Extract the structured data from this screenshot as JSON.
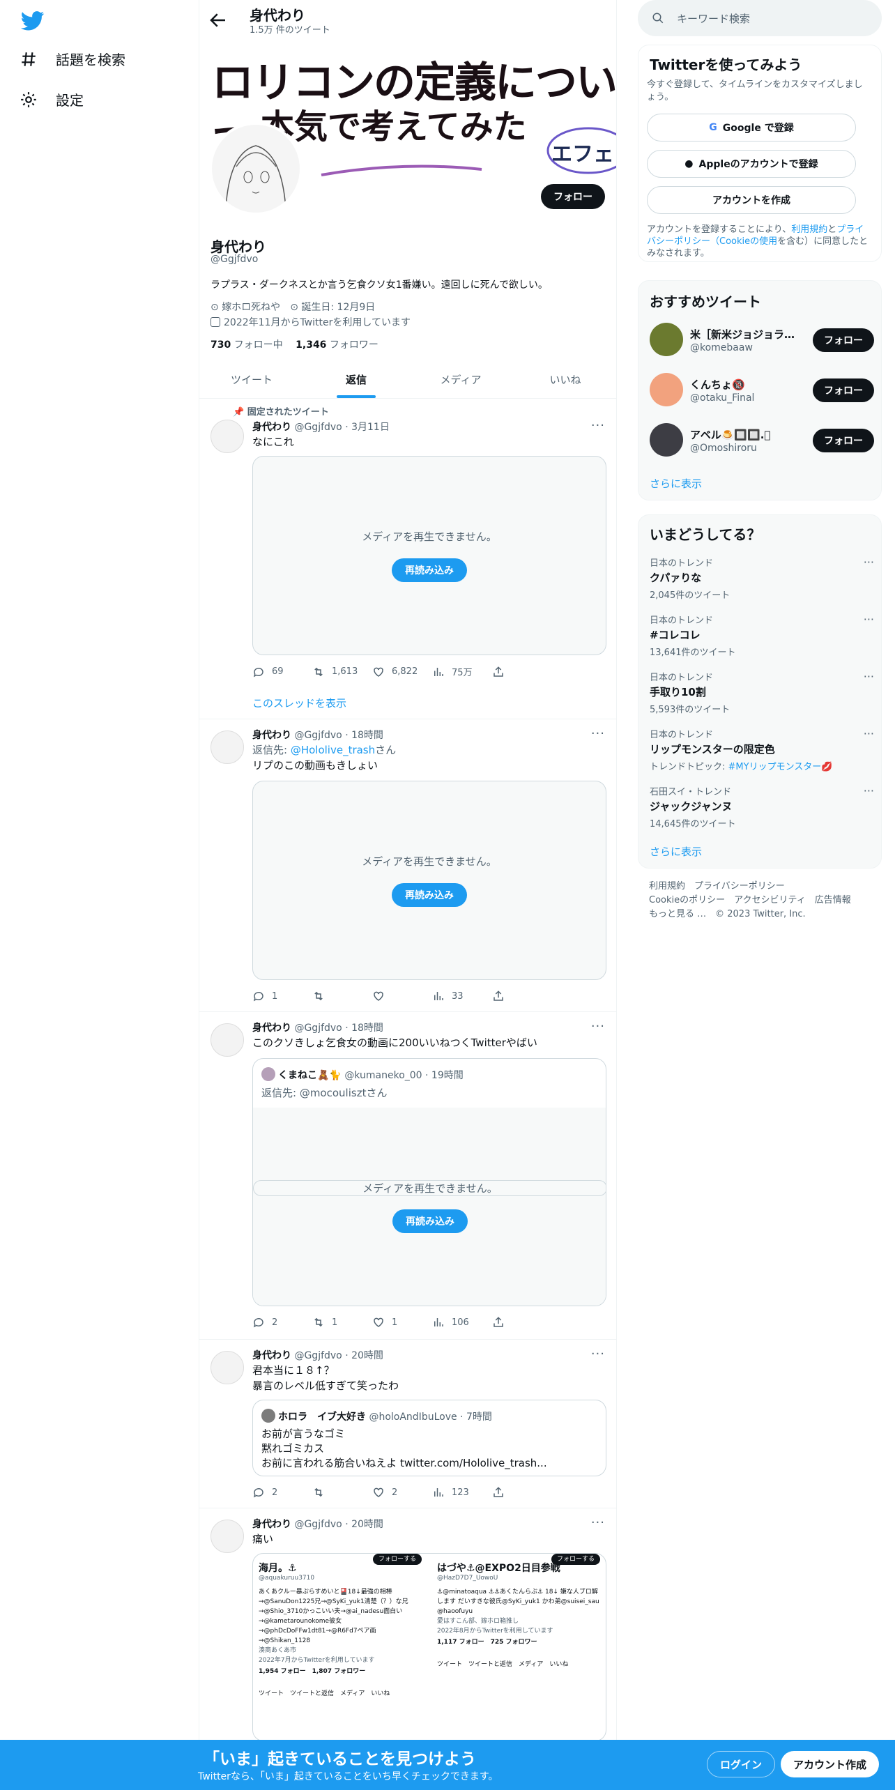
{
  "nav": {
    "explore_label": "話題を検索",
    "settings_label": "設定"
  },
  "header": {
    "title": "身代わり",
    "tweet_count": "1.5万 件のツイート"
  },
  "banner": {
    "line1": "ロリコンの定義について",
    "line2": "本気で考えてみた",
    "side_text": "エフェ"
  },
  "profile": {
    "follow_label": "フォロー",
    "name": "身代わり",
    "handle": "@Ggjfdvo",
    "bio": "ラプラス・ダークネスとか言う乞食クソ女1番嫌い。遠回しに死んで欲しい。",
    "location": "嫁ホロ死ねや",
    "birthday": "誕生日: 12月9日",
    "joined": "2022年11月からTwitterを利用しています",
    "following_count": "730",
    "following_label": "フォロー中",
    "followers_count": "1,346",
    "followers_label": "フォロワー"
  },
  "tabs": [
    {
      "label": "ツイート"
    },
    {
      "label": "返信"
    },
    {
      "label": "メディア"
    },
    {
      "label": "いいね"
    }
  ],
  "pinned_label": "固定されたツイート",
  "media_unavailable": "メディアを再生できません。",
  "reload_label": "再読み込み",
  "tweets": [
    {
      "name": "身代わり",
      "meta": "@Ggjfdvo · 3月11日",
      "text": "なにこれ",
      "reply": "69",
      "retweet": "1,613",
      "like": "6,822",
      "views": "75万",
      "thread_link": "このスレッドを表示"
    },
    {
      "name": "身代わり",
      "meta": "@Ggjfdvo · 18時間",
      "reply_to_prefix": "返信先: ",
      "reply_to_user": "@Hololive_trash",
      "reply_to_suffix": "さん",
      "text": "リプのこの動画もきしょい",
      "reply": "1",
      "retweet": "",
      "like": "",
      "views": "33"
    },
    {
      "name": "身代わり",
      "meta": "@Ggjfdvo · 18時間",
      "text": "このクソきしょ乞食女の動画に200いいねつくTwitterやばい",
      "quote_name": "くまねこ🧸🐈",
      "quote_meta": "@kumaneko_00 · 19時間",
      "quote_reply": "返信先: @mocoulisztさん",
      "reply": "2",
      "retweet": "1",
      "like": "1",
      "views": "106"
    },
    {
      "name": "身代わり",
      "meta": "@Ggjfdvo · 20時間",
      "text1": "君本当に１８↑？",
      "text2": "暴言のレベル低すぎて笑ったわ",
      "quote_name": "ホロラ　イブ大好き",
      "quote_meta": "@holoAndIbuLove · 7時間",
      "quote_l1": "お前が言うなゴミ",
      "quote_l2": "黙れゴミカス",
      "quote_l3": "お前に言われる筋合いねえよ twitter.com/Hololive_trash...",
      "reply": "2",
      "retweet": "",
      "like": "2",
      "views": "123"
    },
    {
      "name": "身代わり",
      "meta": "@Ggjfdvo · 20時間",
      "text": "痛い",
      "shot_left": {
        "follow": "フォローする",
        "name": "海月。⚓",
        "handle": "@aquakuruu3710",
        "bio": "あくあクルー暴ぷらすめいと🎴18↓最強の相棒→@SanuDon1225兄→@SyKi_yuk1清楚（？）な兄→@Shio_3710かっこいい夫→@ai_nadesu面白い→@kametarounokome彼女→@phDcDoFFw1dt81→@R6Fd7ペア画→@Shikan_1128",
        "place": "湊商あくあ市",
        "joined": "2022年7月からTwitterを利用しています",
        "stats": "1,954 フォロー　1,807 フォロワー",
        "tabs": "ツイート　ツイートと返信　メディア　いいね"
      },
      "shot_right": {
        "follow": "フォローする",
        "name": "はづや⚓@EXPO2日目参戦",
        "handle": "@HazD7D7_UowoU",
        "bio": "⚓@minatoaqua ⚓⚓あくたんらぶ⚓ 18↓ 嫌な人ブロ解します だいすきな彼氏@SyKi_yuk1 かわ弟@suisei_sau @haoofuyu",
        "place": "愛はすこん部、嫁ホロ箱推し",
        "joined": "2022年8月からTwitterを利用しています",
        "stats": "1,117 フォロー　725 フォロワー",
        "tabs": "ツイート　ツイートと返信　メディア　いいね"
      }
    }
  ],
  "right": {
    "search_placeholder": "キーワード検索",
    "signup": {
      "title": "Twitterを使ってみよう",
      "desc": "今すぐ登録して、タイムラインをカスタマイズしましょう。",
      "google": "Google で登録",
      "apple": "Appleのアカウントで登録",
      "create": "アカウントを作成",
      "legal_1": "アカウントを登録することにより、",
      "legal_terms": "利用規約",
      "legal_and": "と",
      "legal_privacy": "プライバシーポリシー（Cookieの使用",
      "legal_2": "を含む）に同意したとみなされます。"
    },
    "recommend": {
      "title": "おすすめツイート",
      "users": [
        {
          "name": "米［新米ジョジョラ…",
          "handle": "@komebaaw",
          "follow": "フォロー"
        },
        {
          "name": "くんちょ🔞",
          "handle": "@otaku_Final",
          "follow": "フォロー"
        },
        {
          "name": "アベル🍮🔲🔲.ﾟ",
          "handle": "@Omoshiroru",
          "follow": "フォロー"
        }
      ],
      "more": "さらに表示"
    },
    "trends": {
      "title": "いまどうしてる？",
      "items": [
        {
          "context": "日本のトレンド",
          "name": "クパァりな",
          "count": "2,045件のツイート"
        },
        {
          "context": "日本のトレンド",
          "name": "#コレコレ",
          "count": "13,641件のツイート"
        },
        {
          "context": "日本のトレンド",
          "name": "手取り10割",
          "count": "5,593件のツイート"
        },
        {
          "context": "日本のトレンド",
          "name": "リップモンスターの限定色",
          "count_prefix": "トレンドトピック: ",
          "count_link": "#MYリップモンスター💋"
        },
        {
          "context": "石田スイ・トレンド",
          "name": "ジャックジャンヌ",
          "count": "14,645件のツイート"
        }
      ],
      "more": "さらに表示"
    },
    "footer": {
      "l1": "利用規約　プライバシーポリシー",
      "l2": "Cookieのポリシー　アクセシビリティ　広告情報",
      "l3": "もっと見る …　© 2023 Twitter, Inc."
    }
  },
  "bottom": {
    "headline": "「いま」起きていることを見つけよう",
    "sub": "Twitterなら、「いま」起きていることをいち早くチェックできます。",
    "login": "ログイン",
    "signup": "アカウント作成"
  },
  "colors": {
    "accent": "#1d9bf0",
    "text": "#0f1419",
    "muted": "#536471"
  }
}
